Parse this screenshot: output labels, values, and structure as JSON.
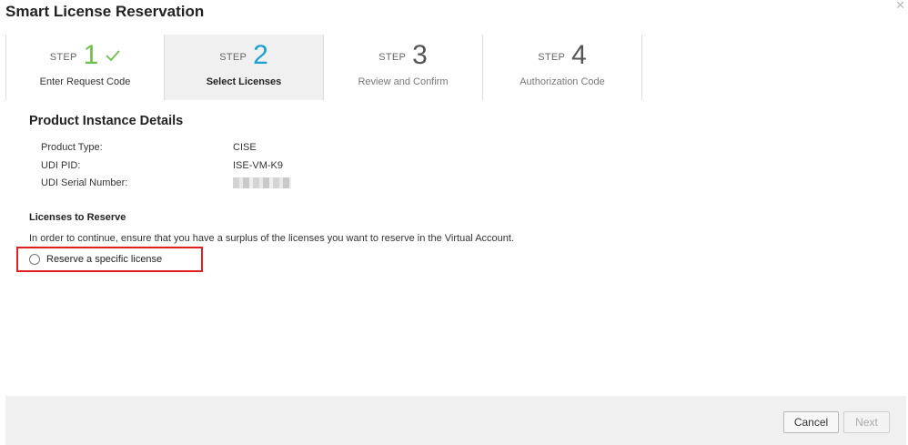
{
  "dialog": {
    "title": "Smart License Reservation",
    "close_icon": "close-icon"
  },
  "steps": [
    {
      "word": "STEP",
      "number": "1",
      "label": "Enter Request Code",
      "state": "completed",
      "icon": "check-icon"
    },
    {
      "word": "STEP",
      "number": "2",
      "label": "Select Licenses",
      "state": "active"
    },
    {
      "word": "STEP",
      "number": "3",
      "label": "Review and Confirm",
      "state": "pending"
    },
    {
      "word": "STEP",
      "number": "4",
      "label": "Authorization Code",
      "state": "pending"
    }
  ],
  "details": {
    "title": "Product Instance Details",
    "rows": [
      {
        "label": "Product Type:",
        "value": "CISE"
      },
      {
        "label": "UDI PID:",
        "value": "ISE-VM-K9"
      },
      {
        "label": "UDI Serial Number:",
        "value": ""
      }
    ]
  },
  "licenses": {
    "title": "Licenses to Reserve",
    "notice": "In order to continue, ensure that you have a surplus of the licenses you want to reserve in the Virtual Account.",
    "option_label": "Reserve a specific license",
    "option_selected": false
  },
  "footer": {
    "cancel_label": "Cancel",
    "next_label": "Next",
    "next_enabled": false
  },
  "colors": {
    "step_done": "#6ebe4a",
    "step_active": "#1a9fce",
    "highlight_border": "#e02020"
  }
}
